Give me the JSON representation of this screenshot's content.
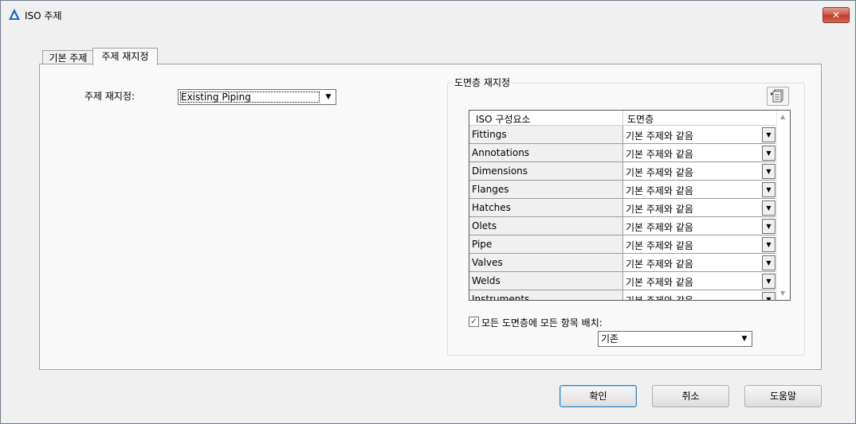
{
  "window": {
    "title": "ISO 주제",
    "close_label": "✕",
    "accent_color": "#1e64c8"
  },
  "tabs": [
    {
      "label": "기본 주제",
      "active": false
    },
    {
      "label": "주제 재지정",
      "active": true
    }
  ],
  "theme_remap": {
    "label": "주제 재지정:",
    "value": "Existing Piping",
    "arrow": "▼"
  },
  "layer_remap": {
    "group_title": "도면층 재지정",
    "icon": "layer-properties-icon",
    "columns": [
      "ISO 구성요소",
      "도면층"
    ],
    "rows": [
      {
        "component": "Fittings",
        "layer": "기본 주제와 같음"
      },
      {
        "component": "Annotations",
        "layer": "기본 주제와 같음"
      },
      {
        "component": "Dimensions",
        "layer": "기본 주제와 같음"
      },
      {
        "component": "Flanges",
        "layer": "기본 주제와 같음"
      },
      {
        "component": "Hatches",
        "layer": "기본 주제와 같음"
      },
      {
        "component": "Olets",
        "layer": "기본 주제와 같음"
      },
      {
        "component": "Pipe",
        "layer": "기본 주제와 같음"
      },
      {
        "component": "Valves",
        "layer": "기본 주제와 같음"
      },
      {
        "component": "Welds",
        "layer": "기본 주제와 같음"
      },
      {
        "component": "Instruments",
        "layer": "기본 주제와 같음"
      }
    ],
    "scroll_up": "▲",
    "scroll_down": "▼",
    "row_arrow": "▼",
    "place_all": {
      "checked": true,
      "check_glyph": "✓",
      "label": "모든 도면층에 모든 항목 배치:"
    },
    "place_all_layer": {
      "value": "기존",
      "arrow": "▼"
    }
  },
  "buttons": {
    "ok": "확인",
    "cancel": "취소",
    "help": "도움말"
  }
}
